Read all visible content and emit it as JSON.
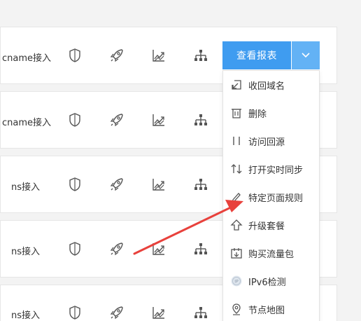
{
  "rows": [
    {
      "access": "cname接入"
    },
    {
      "access": "cname接入"
    },
    {
      "access": "ns接入"
    },
    {
      "access": "ns接入"
    },
    {
      "access": "ns接入"
    }
  ],
  "row_icons": [
    "shield-icon",
    "rocket-icon",
    "chart-trend-icon",
    "topology-icon"
  ],
  "report_button": {
    "label": "查看报表"
  },
  "menu": {
    "items": [
      {
        "label": "收回域名",
        "icon": "reclaim-icon"
      },
      {
        "label": "删除",
        "icon": "trash-icon"
      },
      {
        "label": "访问回源",
        "icon": "origin-icon"
      },
      {
        "label": "打开实时同步",
        "icon": "sync-icon"
      },
      {
        "label": "特定页面规则",
        "icon": "pencil-icon"
      },
      {
        "label": "升级套餐",
        "icon": "upgrade-arrow-icon"
      },
      {
        "label": "购买流量包",
        "icon": "traffic-package-icon"
      },
      {
        "label": "IPv6检测",
        "icon": "ipv6-icon"
      },
      {
        "label": "节点地图",
        "icon": "map-pin-icon"
      }
    ]
  },
  "colors": {
    "primary": "#3f9cf0",
    "primary_light": "#63b2f5",
    "annotation_arrow": "#e8413c",
    "icon": "#555555"
  }
}
